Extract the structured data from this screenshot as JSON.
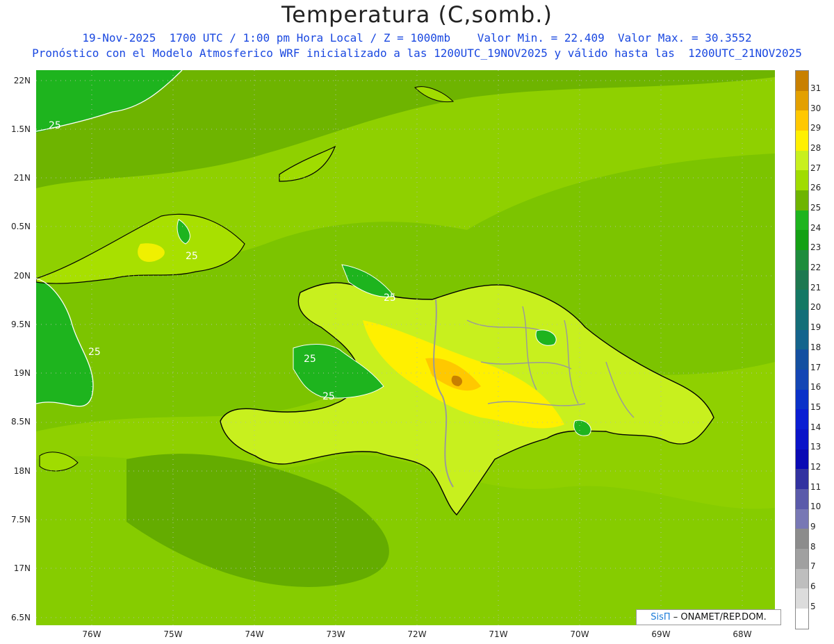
{
  "title": "Temperatura (C,somb.)",
  "subtitle_line1": "19-Nov-2025  1700 UTC / 1:00 pm Hora Local / Z = 1000mb    Valor Min. = 22.409  Valor Max. = 30.3552",
  "subtitle_line2": "Pronóstico con el Modelo Atmosferico WRF inicializado a las 1200UTC_19NOV2025 y válido hasta las  1200UTC_21NOV2025",
  "y_ticks": [
    "22N",
    "1.5N",
    "21N",
    "0.5N",
    "20N",
    "9.5N",
    "19N",
    "8.5N",
    "18N",
    "7.5N",
    "17N",
    "6.5N"
  ],
  "x_ticks": [
    "76W",
    "75W",
    "74W",
    "73W",
    "72W",
    "71W",
    "70W",
    "69W",
    "68W"
  ],
  "contour_label": "25",
  "credit": {
    "brand": "SisΠ",
    "text": " – ONAMET/REP.DOM."
  },
  "legend": {
    "labels": [
      "31",
      "30",
      "29",
      "28",
      "27",
      "26",
      "25",
      "24",
      "23",
      "22",
      "21",
      "20",
      "19",
      "18",
      "17",
      "16",
      "15",
      "14",
      "13",
      "12",
      "11",
      "10",
      "9",
      "8",
      "7",
      "6",
      "5"
    ],
    "colors": [
      "#c88000",
      "#e3a000",
      "#ffc800",
      "#fff000",
      "#c8f01e",
      "#a0dc00",
      "#6eb400",
      "#1eb41e",
      "#14a014",
      "#1e8c3c",
      "#1e7850",
      "#147864",
      "#146e78",
      "#14648c",
      "#1450a0",
      "#1446b4",
      "#0a32c8",
      "#0a1ed2",
      "#0a14c8",
      "#0a0ab4",
      "#3232a0",
      "#5a5aaa",
      "#7878b4",
      "#8c8c8c",
      "#a0a0a0",
      "#bebebe",
      "#dcdcdc",
      "#ffffff"
    ]
  }
}
